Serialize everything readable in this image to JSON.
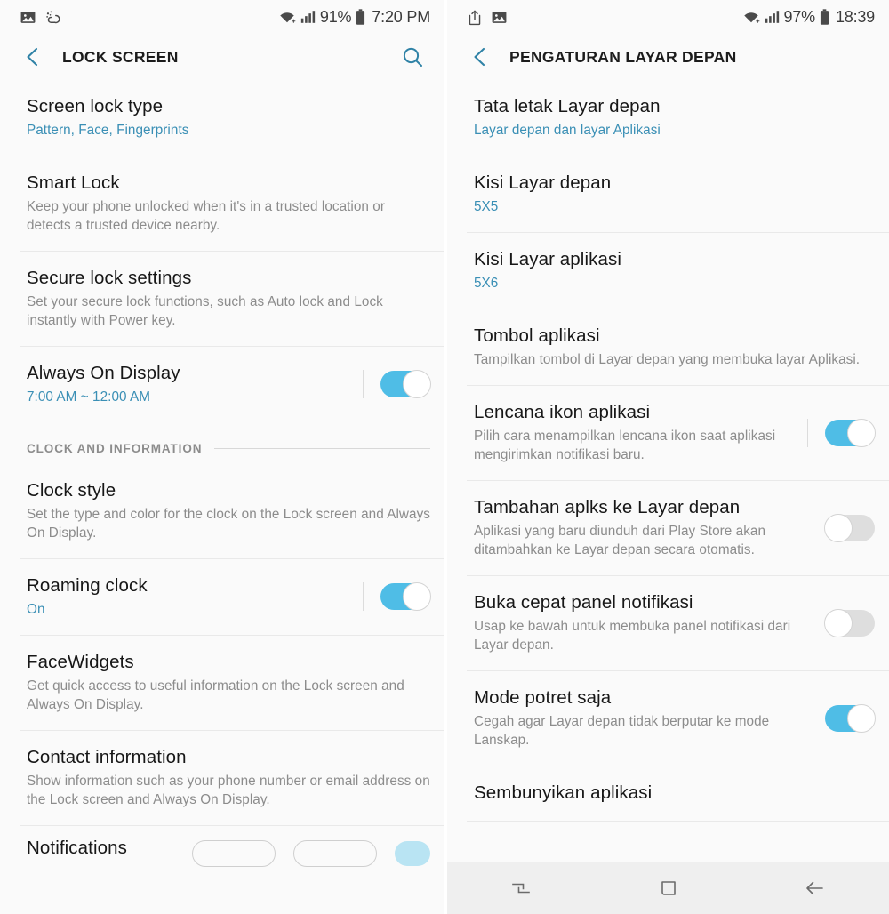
{
  "left_screen": {
    "status_bar": {
      "icons": [
        "image-icon",
        "weather-icon"
      ],
      "battery_percent": "91%",
      "time": "7:20 PM"
    },
    "app_bar": {
      "back": "back-chevron-icon",
      "title": "LOCK SCREEN",
      "search": "search-icon"
    },
    "items": [
      {
        "title": "Screen lock type",
        "sub": "Pattern, Face, Fingerprints",
        "sub_style": "accent",
        "toggle": null
      },
      {
        "title": "Smart Lock",
        "sub": "Keep your phone unlocked when it's in a trusted location or detects a trusted device nearby.",
        "sub_style": "muted",
        "toggle": null
      },
      {
        "title": "Secure lock settings",
        "sub": "Set your secure lock functions, such as Auto lock and Lock instantly with Power key.",
        "sub_style": "muted",
        "toggle": null
      },
      {
        "title": "Always On Display",
        "sub": "7:00 AM ~ 12:00 AM",
        "sub_style": "accent",
        "toggle": "on"
      }
    ],
    "section_header": "CLOCK AND INFORMATION",
    "items2": [
      {
        "title": "Clock style",
        "sub": "Set the type and color for the clock on the Lock screen and Always On Display.",
        "sub_style": "muted",
        "toggle": null
      },
      {
        "title": "Roaming clock",
        "sub": "On",
        "sub_style": "accent",
        "toggle": "on"
      },
      {
        "title": "FaceWidgets",
        "sub": "Get quick access to useful information on the Lock screen and Always On Display.",
        "sub_style": "muted",
        "toggle": null
      },
      {
        "title": "Contact information",
        "sub": "Show information such as your phone number or email address on the Lock screen and Always On Display.",
        "sub_style": "muted",
        "toggle": null
      }
    ],
    "partial_item": {
      "title": "Notifications"
    }
  },
  "right_screen": {
    "status_bar": {
      "icons": [
        "share-icon",
        "image-icon"
      ],
      "battery_percent": "97%",
      "time": "18:39"
    },
    "app_bar": {
      "back": "back-chevron-icon",
      "title": "PENGATURAN LAYAR DEPAN"
    },
    "items": [
      {
        "title": "Tata letak Layar depan",
        "sub": "Layar depan dan layar Aplikasi",
        "sub_style": "accent",
        "toggle": null
      },
      {
        "title": "Kisi Layar depan",
        "sub": "5X5",
        "sub_style": "accent",
        "toggle": null
      },
      {
        "title": "Kisi Layar aplikasi",
        "sub": "5X6",
        "sub_style": "accent",
        "toggle": null
      },
      {
        "title": "Tombol aplikasi",
        "sub": "Tampilkan tombol di Layar depan yang membuka layar Aplikasi.",
        "sub_style": "muted",
        "toggle": null
      },
      {
        "title": "Lencana ikon aplikasi",
        "sub": "Pilih cara menampilkan lencana ikon saat aplikasi mengirimkan notifikasi baru.",
        "sub_style": "muted",
        "toggle": "on"
      },
      {
        "title": "Tambahan aplks ke Layar depan",
        "sub": "Aplikasi yang baru diunduh dari Play Store akan ditambahkan ke Layar depan secara otomatis.",
        "sub_style": "muted",
        "toggle": "off"
      },
      {
        "title": "Buka cepat panel notifikasi",
        "sub": "Usap ke bawah untuk membuka panel notifikasi dari Layar depan.",
        "sub_style": "muted",
        "toggle": "off"
      },
      {
        "title": "Mode potret saja",
        "sub": "Cegah agar Layar depan tidak berputar ke mode Lanskap.",
        "sub_style": "muted",
        "toggle": "on"
      },
      {
        "title": "Sembunyikan aplikasi",
        "sub": null,
        "sub_style": "muted",
        "toggle": null
      }
    ],
    "nav_bar": {
      "recents": "recents-icon",
      "home": "home-icon",
      "back": "back-arrow-icon"
    }
  },
  "colors": {
    "accent_text": "#3a8fb5",
    "toggle_on": "#4fbde6",
    "toggle_off": "#dedede",
    "icon_blue": "#2f82a6",
    "background": "#fafafa",
    "title_text": "#171717",
    "sub_text": "#8c8c8c",
    "navbar_bg": "#efefef"
  }
}
